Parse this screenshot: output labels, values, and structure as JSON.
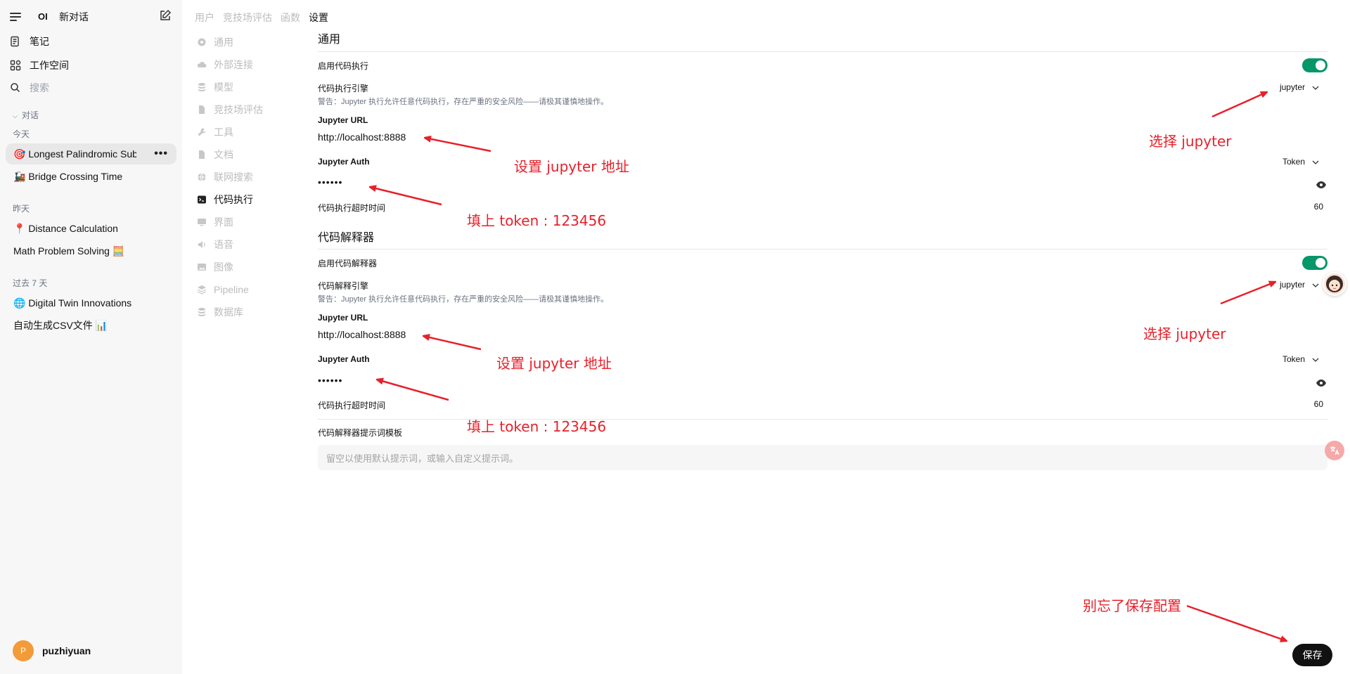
{
  "sidebar": {
    "logo": "OI",
    "new_chat": "新对话",
    "notes": "笔记",
    "workspace": "工作空间",
    "search_placeholder": "搜索",
    "section_chats": "对话",
    "groups": [
      {
        "label": "今天",
        "chats": [
          "🎯 Longest Palindromic Subs",
          "🚂 Bridge Crossing Time"
        ]
      },
      {
        "label": "昨天",
        "chats": [
          "📍 Distance Calculation",
          "Math Problem Solving 🧮"
        ]
      },
      {
        "label": "过去 7 天",
        "chats": [
          "🌐 Digital Twin Innovations",
          "自动生成CSV文件 📊"
        ]
      }
    ],
    "active_chat_more": "•••",
    "user": {
      "initial": "P",
      "name": "puzhiyuan"
    }
  },
  "tabs": [
    "用户",
    "竞技场评估",
    "函数",
    "设置"
  ],
  "settings_nav": [
    "通用",
    "外部连接",
    "模型",
    "竞技场评估",
    "工具",
    "文档",
    "联网搜索",
    "代码执行",
    "界面",
    "语音",
    "图像",
    "Pipeline",
    "数据库"
  ],
  "general": {
    "title": "通用",
    "enable_exec": "启用代码执行",
    "engine_label": "代码执行引擎",
    "engine_value": "jupyter",
    "warning": "警告：Jupyter 执行允许任意代码执行，存在严重的安全风险——请极其谨慎地操作。",
    "url_label": "Jupyter URL",
    "url_value": "http://localhost:8888",
    "auth_label": "Jupyter Auth",
    "auth_value": "Token",
    "password_mask": "••••••",
    "timeout_label": "代码执行超时时间",
    "timeout_value": "60"
  },
  "interpreter": {
    "title": "代码解释器",
    "enable": "启用代码解释器",
    "engine_label": "代码解释引擎",
    "engine_value": "jupyter",
    "warning": "警告：Jupyter 执行允许任意代码执行，存在严重的安全风险——请极其谨慎地操作。",
    "url_label": "Jupyter URL",
    "url_value": "http://localhost:8888",
    "auth_label": "Jupyter Auth",
    "auth_value": "Token",
    "password_mask": "••••••",
    "timeout_label": "代码执行超时时间",
    "timeout_value": "60",
    "prompt_label": "代码解释器提示词模板",
    "prompt_placeholder": "留空以使用默认提示词，或输入自定义提示词。"
  },
  "save_label": "保存",
  "annotations": {
    "set_url_1": "设置 jupyter 地址",
    "token_1": "填上 token : 123456",
    "choose_1": "选择 jupyter",
    "set_url_2": "设置 jupyter 地址",
    "token_2": "填上 token : 123456",
    "choose_2": "选择 jupyter",
    "save_reminder": "别忘了保存配置"
  },
  "colors": {
    "toggle_on": "#059669",
    "annotation": "#e8202a",
    "avatar": "#f29b38"
  }
}
